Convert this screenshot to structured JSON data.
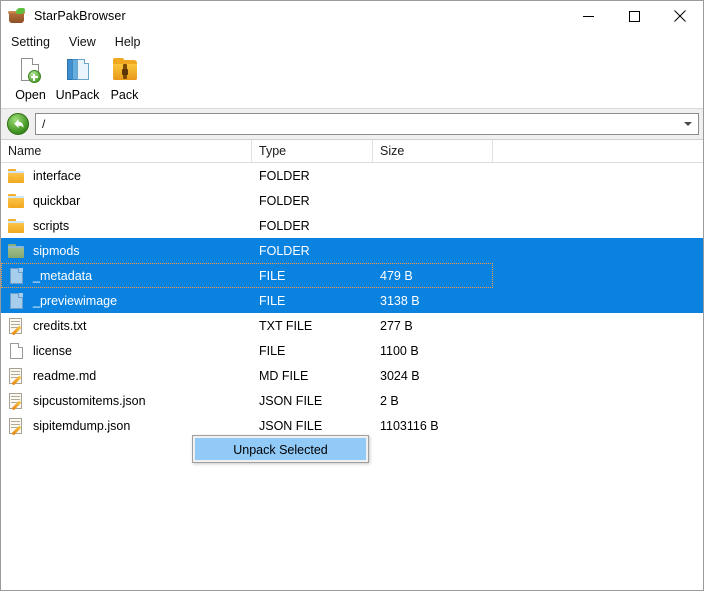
{
  "window": {
    "title": "StarPakBrowser",
    "app_icon": "pot-icon",
    "controls": {
      "minimize": "minimize-icon",
      "maximize": "maximize-icon",
      "close": "close-icon"
    }
  },
  "menubar": {
    "items": [
      {
        "label": "Setting"
      },
      {
        "label": "View"
      },
      {
        "label": "Help"
      }
    ]
  },
  "toolbar": {
    "buttons": [
      {
        "label": "Open",
        "icon": "open-file-icon"
      },
      {
        "label": "UnPack",
        "icon": "unpack-icon"
      },
      {
        "label": "Pack",
        "icon": "pack-folder-icon"
      }
    ]
  },
  "addressbar": {
    "back_icon": "back-arrow-icon",
    "path": "/",
    "dropdown_icon": "chevron-down-icon"
  },
  "filelist": {
    "columns": [
      {
        "label": "Name"
      },
      {
        "label": "Type"
      },
      {
        "label": "Size"
      }
    ],
    "rows": [
      {
        "name": "interface",
        "type": "FOLDER",
        "size": "",
        "icon": "folder-icon",
        "selected": false,
        "focused": false
      },
      {
        "name": "quickbar",
        "type": "FOLDER",
        "size": "",
        "icon": "folder-icon",
        "selected": false,
        "focused": false
      },
      {
        "name": "scripts",
        "type": "FOLDER",
        "size": "",
        "icon": "folder-icon",
        "selected": false,
        "focused": false
      },
      {
        "name": "sipmods",
        "type": "FOLDER",
        "size": "",
        "icon": "folder-icon",
        "selected": true,
        "focused": false
      },
      {
        "name": "_metadata",
        "type": "FILE",
        "size": "479 B",
        "icon": "file-icon",
        "selected": true,
        "focused": true
      },
      {
        "name": "_previewimage",
        "type": "FILE",
        "size": "3138 B",
        "icon": "file-icon",
        "selected": true,
        "focused": false
      },
      {
        "name": "credits.txt",
        "type": "TXT FILE",
        "size": "277 B",
        "icon": "text-file-icon",
        "selected": false,
        "focused": false
      },
      {
        "name": "license",
        "type": "FILE",
        "size": "1100 B",
        "icon": "file-icon",
        "selected": false,
        "focused": false
      },
      {
        "name": "readme.md",
        "type": "MD FILE",
        "size": "3024 B",
        "icon": "text-file-icon",
        "selected": false,
        "focused": false
      },
      {
        "name": "sipcustomitems.json",
        "type": "JSON FILE",
        "size": "2 B",
        "icon": "text-file-icon",
        "selected": false,
        "focused": false
      },
      {
        "name": "sipitemdump.json",
        "type": "JSON FILE",
        "size": "1103116 B",
        "icon": "text-file-icon",
        "selected": false,
        "focused": false
      }
    ]
  },
  "context_menu": {
    "items": [
      {
        "label": "Unpack Selected",
        "highlighted": true
      }
    ]
  },
  "colors": {
    "selection": "#0a82e0",
    "menu_highlight": "#91c9f7",
    "focus_outline": "#ff9c3a",
    "folder": "#f2a91d"
  }
}
